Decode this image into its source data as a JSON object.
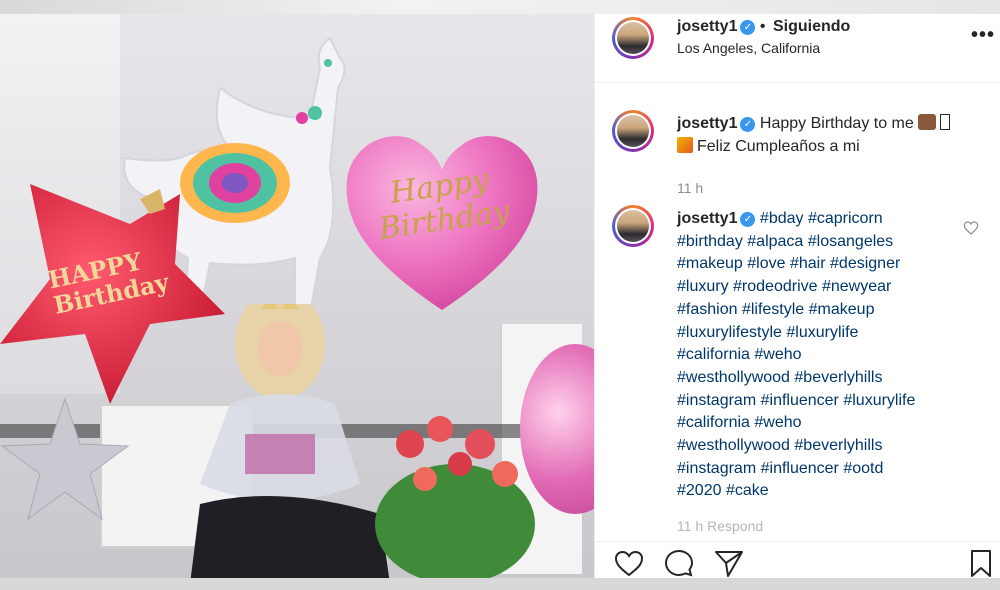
{
  "header": {
    "username": "josetty1",
    "separator": "•",
    "following_label": "Siguiendo",
    "location": "Los Angeles, California",
    "more_label": "•••"
  },
  "caption": {
    "username": "josetty1",
    "line1": "Happy Birthday to me",
    "line2": "Feliz Cumpleaños a mi",
    "time": "11 h"
  },
  "hashtag_comment": {
    "username": "josetty1",
    "lines": [
      [
        "#bday",
        "#capricorn"
      ],
      [
        "#birthday",
        "#alpaca",
        "#losangeles"
      ],
      [
        "#makeup",
        "#love",
        "#hair",
        "#designer"
      ],
      [
        "#luxury",
        "#rodeodrive",
        "#newyear"
      ],
      [
        "#fashion",
        "#lifestyle",
        "#makeup"
      ],
      [
        "#luxurylifestyle",
        "#luxurylife"
      ],
      [
        "#california",
        "#weho"
      ],
      [
        "#westhollywood",
        "#beverlyhills"
      ],
      [
        "#instagram",
        "#influencer",
        "#luxurylife"
      ],
      [
        "#california",
        "#weho"
      ],
      [
        "#westhollywood",
        "#beverlyhills"
      ],
      [
        "#instagram",
        "#influencer",
        "#ootd"
      ],
      [
        "#2020",
        "#cake"
      ]
    ],
    "partial_footer": "11 h   Respond"
  },
  "photo": {
    "heart_balloon_text": "Happy Birthday",
    "star_balloon_text": "HAPPY Birthday"
  },
  "icons": {
    "verified": "verified-badge-icon",
    "like": "heart-icon",
    "comment": "comment-icon",
    "share": "paper-plane-icon",
    "save": "bookmark-icon"
  },
  "colors": {
    "verified_blue": "#3897f0",
    "hashtag_blue": "#00376b",
    "meta_gray": "#8e8e8e"
  }
}
